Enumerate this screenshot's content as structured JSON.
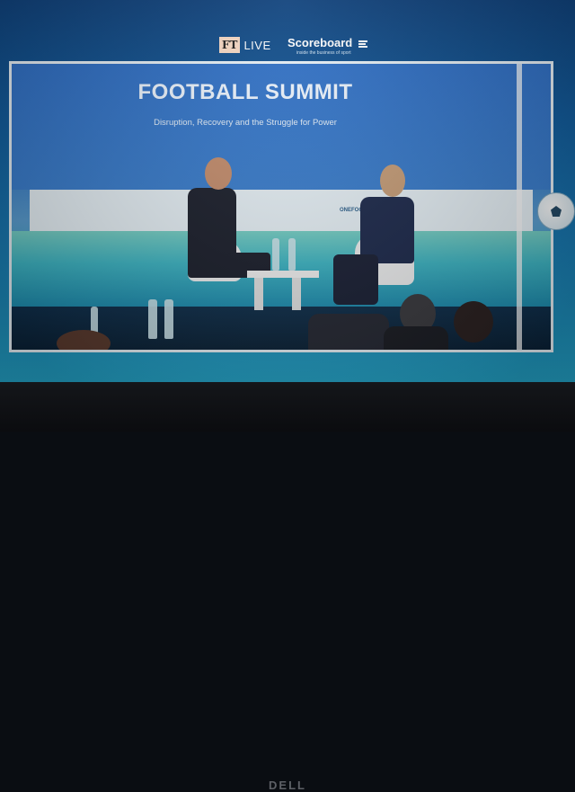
{
  "header": {
    "ft_mark": "FT",
    "ft_live": "LIVE",
    "scoreboard": "Scoreboard",
    "scoreboard_tagline": "inside the business of sport"
  },
  "stream": {
    "title": "FOOTBALL SUMMIT",
    "subtitle": "Disruption, Recovery and the Struggle for Power",
    "sponsors": [
      "",
      "ONEFOOTBALL",
      ""
    ]
  },
  "laptop": {
    "brand": "DELL"
  },
  "colors": {
    "screen_bg": "#0f5a9c",
    "title_text": "#eef6ff",
    "ft_pink": "#f7d9c4"
  }
}
